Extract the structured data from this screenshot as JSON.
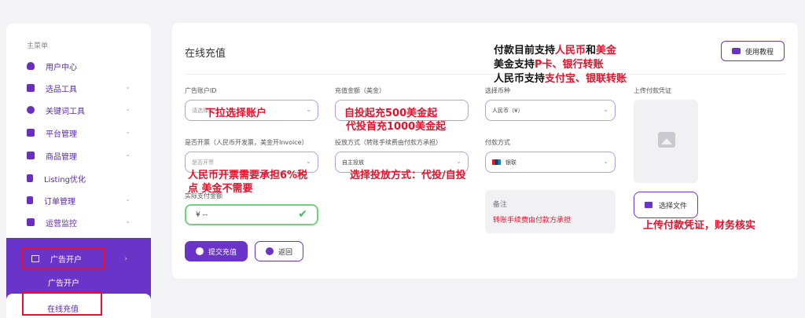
{
  "sidebar": {
    "menu_title": "主菜单",
    "items": [
      {
        "label": "用户中心",
        "icon": "cloud-icon"
      },
      {
        "label": "选品工具",
        "icon": "bag-icon"
      },
      {
        "label": "关键词工具",
        "icon": "chat-icon"
      },
      {
        "label": "平台管理",
        "icon": "monitor-icon"
      },
      {
        "label": "商品管理",
        "icon": "box-icon"
      },
      {
        "label": "Listing优化",
        "icon": "doc-icon"
      },
      {
        "label": "订单管理",
        "icon": "clipboard-icon"
      },
      {
        "label": "运营监控",
        "icon": "chart-icon"
      }
    ],
    "ad_section": {
      "label": "广告开户",
      "sub_item": "广告开户",
      "active_item": "在线充值"
    }
  },
  "main": {
    "title": "在线充值",
    "tutorial_button": "使用教程",
    "fields": {
      "ad_account": {
        "label": "广告账户ID",
        "placeholder": "请选择账户"
      },
      "amount": {
        "label": "充值金额（美金）"
      },
      "currency": {
        "label": "选择币种",
        "value": "人民币（¥）"
      },
      "upload": {
        "label": "上传付款凭证"
      },
      "invoice": {
        "label": "是否开票（人民币开发票，美金开Invoice）",
        "placeholder": "是否开票"
      },
      "delivery": {
        "label": "投放方式（转账手续费由付款方承担）",
        "value": "自主投放"
      },
      "payment": {
        "label": "付款方式",
        "value": "银联"
      },
      "actual_amount": {
        "label": "实际支付金额",
        "value": "¥ --"
      }
    },
    "note": {
      "title": "备注",
      "text": "转账手续费由付款方承担"
    },
    "choose_file": "选择文件",
    "submit": "提交充值",
    "back": "返回"
  },
  "annotations": {
    "pay_line1_a": "付款目前支持",
    "pay_line1_b": "人民币",
    "pay_line1_c": "和",
    "pay_line1_d": "美金",
    "pay_line2_a": "美金支持",
    "pay_line2_b": "P卡、银行转账",
    "pay_line3_a": "人民币支持",
    "pay_line3_b": "支付宝、银联转账",
    "dropdown_hint": "下拉选择账户",
    "min_amount_1": "自投起充500美金起",
    "min_amount_2": "代投首充1000美金起",
    "tax_1": "人民币开票需要承担6%税",
    "tax_2": "点 美金不需要",
    "delivery_hint": "选择投放方式：代投/自投",
    "upload_hint": "上传付款凭证，财务核实"
  }
}
